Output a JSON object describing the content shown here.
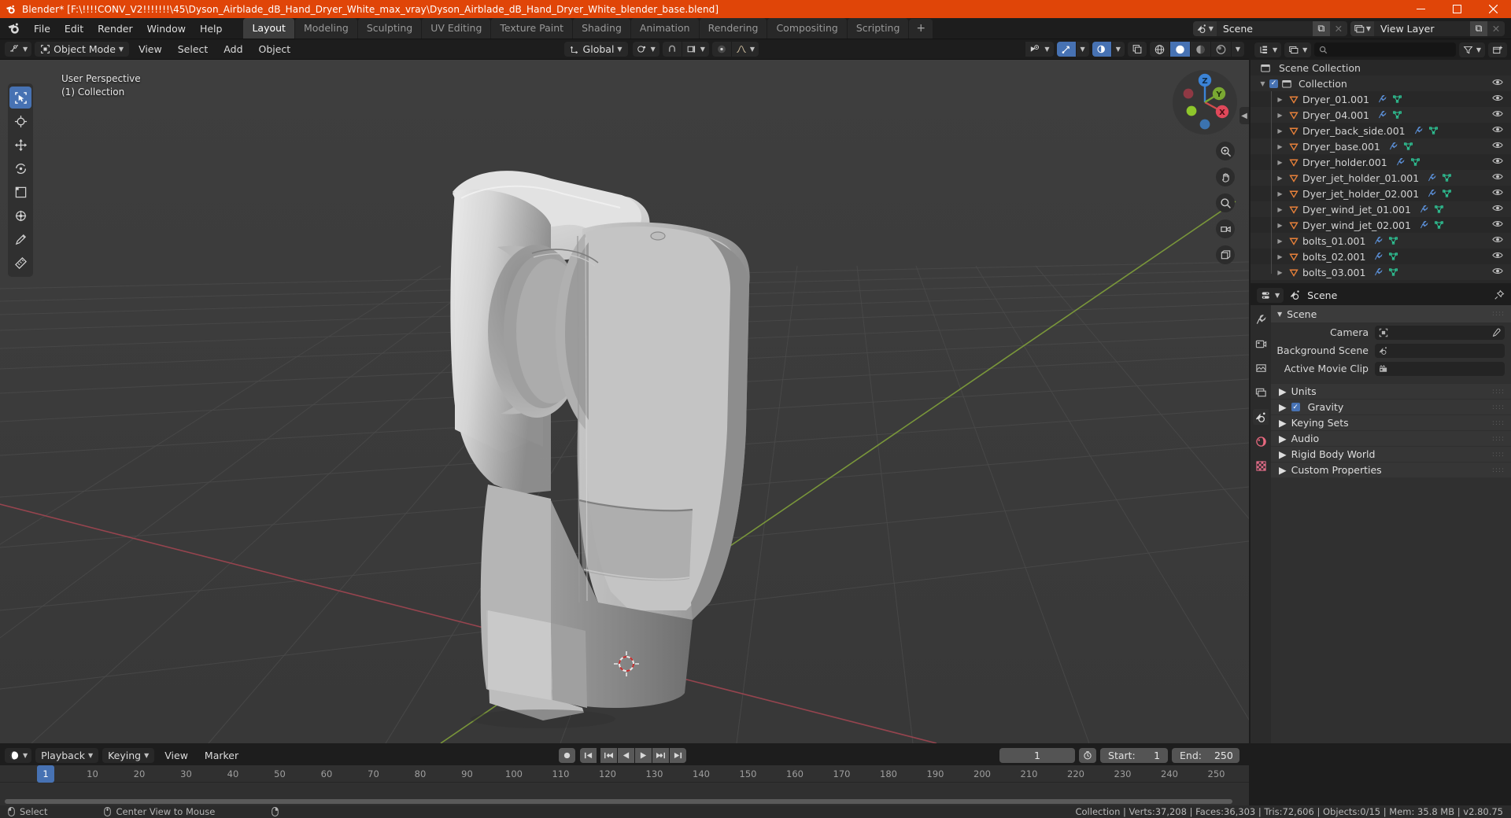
{
  "window": {
    "title": "Blender* [F:\\!!!!CONV_V2!!!!!!!\\45\\Dyson_Airblade_dB_Hand_Dryer_White_max_vray\\Dyson_Airblade_dB_Hand_Dryer_White_blender_base.blend]",
    "minimize": "─",
    "maximize": "☐",
    "close": "✕"
  },
  "menubar": {
    "items": [
      "File",
      "Edit",
      "Render",
      "Window",
      "Help"
    ],
    "workspace_tabs": [
      {
        "label": "Layout",
        "active": true
      },
      {
        "label": "Modeling",
        "active": false
      },
      {
        "label": "Sculpting",
        "active": false
      },
      {
        "label": "UV Editing",
        "active": false
      },
      {
        "label": "Texture Paint",
        "active": false
      },
      {
        "label": "Shading",
        "active": false
      },
      {
        "label": "Animation",
        "active": false
      },
      {
        "label": "Rendering",
        "active": false
      },
      {
        "label": "Compositing",
        "active": false
      },
      {
        "label": "Scripting",
        "active": false
      }
    ],
    "add_workspace_label": "+",
    "scene": {
      "name": "Scene",
      "new_label": "⧉",
      "unlink_label": "✕"
    },
    "view_layer": {
      "name": "View Layer",
      "new_label": "⧉",
      "unlink_label": "✕"
    }
  },
  "viewport": {
    "mode": "Object Mode",
    "menus": [
      "View",
      "Select",
      "Add",
      "Object"
    ],
    "transform_orientation": "Global",
    "overlay_line1": "User Perspective",
    "overlay_line2": "(1) Collection",
    "gizmo_axes": [
      "X",
      "Y",
      "Z"
    ],
    "tools": [
      {
        "name": "select-box-tool",
        "active": true
      },
      {
        "name": "cursor-tool",
        "active": false
      },
      {
        "name": "move-tool",
        "active": false
      },
      {
        "name": "rotate-tool",
        "active": false
      },
      {
        "name": "scale-tool",
        "active": false
      },
      {
        "name": "transform-tool",
        "active": false
      },
      {
        "name": "annotate-tool",
        "active": false
      },
      {
        "name": "measure-tool",
        "active": false
      }
    ],
    "shading_modes": [
      "wireframe",
      "solid",
      "material-preview",
      "rendered"
    ],
    "active_shading_mode": "solid"
  },
  "timeline": {
    "editor_type": "timeline",
    "menus": [
      "Playback",
      "Keying",
      "View",
      "Marker"
    ],
    "current_frame": "1",
    "start_label": "Start:",
    "start_value": "1",
    "end_label": "End:",
    "end_value": "250",
    "ticks": [
      "10",
      "20",
      "30",
      "40",
      "50",
      "60",
      "70",
      "80",
      "90",
      "100",
      "110",
      "120",
      "130",
      "140",
      "150",
      "160",
      "170",
      "180",
      "190",
      "200",
      "210",
      "220",
      "230",
      "240",
      "250"
    ],
    "playhead_label": "1"
  },
  "outliner": {
    "search_placeholder": "",
    "scene_collection": "Scene Collection",
    "collection": "Collection",
    "items": [
      {
        "label": "Dryer_01.001",
        "indent": 0
      },
      {
        "label": "Dryer_04.001",
        "indent": 0
      },
      {
        "label": "Dryer_back_side.001",
        "indent": 0
      },
      {
        "label": "Dryer_base.001",
        "indent": 0
      },
      {
        "label": "Dryer_holder.001",
        "indent": 0
      },
      {
        "label": "Dyer_jet_holder_01.001",
        "indent": 0
      },
      {
        "label": "Dyer_jet_holder_02.001",
        "indent": 0
      },
      {
        "label": "Dyer_wind_jet_01.001",
        "indent": 0
      },
      {
        "label": "Dyer_wind_jet_02.001",
        "indent": 0
      },
      {
        "label": "bolts_01.001",
        "indent": 0
      },
      {
        "label": "bolts_02.001",
        "indent": 0
      },
      {
        "label": "bolts_03.001",
        "indent": 0
      }
    ]
  },
  "properties": {
    "breadcrumb": "Scene",
    "panel_title": "Scene",
    "rows": [
      {
        "label": "Camera",
        "value": ""
      },
      {
        "label": "Background Scene",
        "value": ""
      },
      {
        "label": "Active Movie Clip",
        "value": ""
      }
    ],
    "subpanels": [
      {
        "label": "Units",
        "checkbox": false
      },
      {
        "label": "Gravity",
        "checkbox": true
      },
      {
        "label": "Keying Sets",
        "checkbox": false
      },
      {
        "label": "Audio",
        "checkbox": false
      },
      {
        "label": "Rigid Body World",
        "checkbox": false
      },
      {
        "label": "Custom Properties",
        "checkbox": false
      }
    ]
  },
  "statusbar": {
    "left_action": "Select",
    "mid_action": "Center View to Mouse",
    "stats": "Collection | Verts:37,208 | Faces:36,303 | Tris:72,606 | Objects:0/15 | Mem: 35.8 MB | v2.80.75"
  },
  "colors": {
    "title_bg": "#e04508",
    "accent_blue": "#4772b3",
    "viewport_bg": "#3b3b3b",
    "object_orange": "#e8813a",
    "mesh_green": "#2ecc9b",
    "modifier_blue": "#4a90e2"
  }
}
